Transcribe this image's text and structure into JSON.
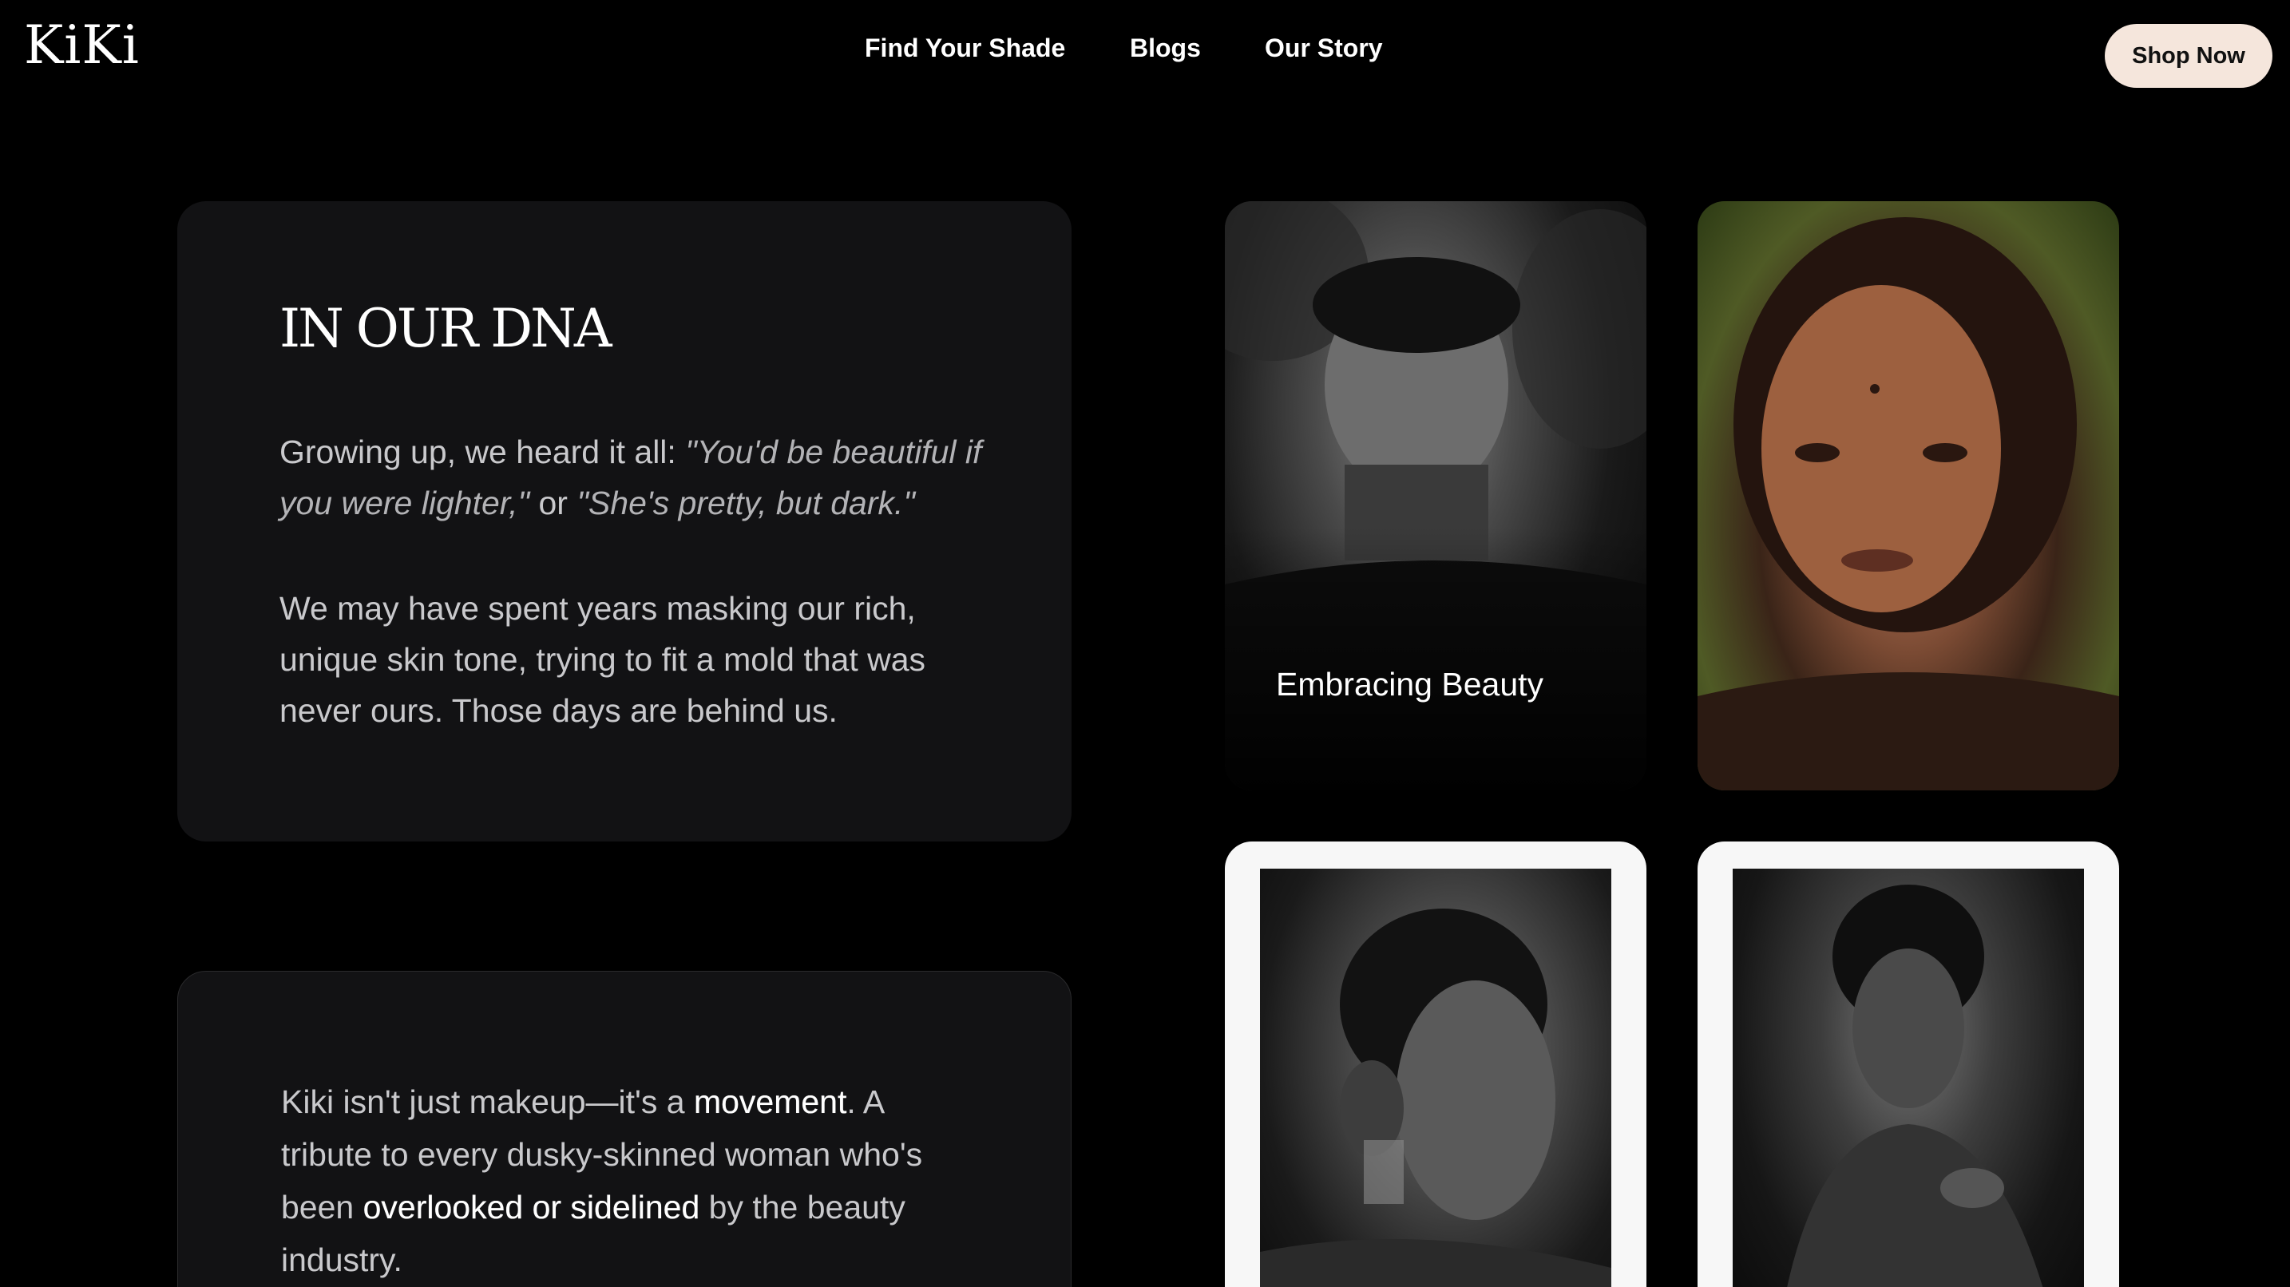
{
  "header": {
    "logo": "KiKi",
    "nav": [
      {
        "label": "Find Your Shade"
      },
      {
        "label": "Blogs"
      },
      {
        "label": "Our Story"
      }
    ],
    "cta": "Shop Now"
  },
  "dna_card": {
    "title": "IN OUR DNA",
    "para1_lead": "Growing up, we heard it all: ",
    "para1_quote1": "\"You'd be beautiful if you were lighter,\"",
    "para1_or": " or ",
    "para1_quote2": "\"She's pretty, but dark.\"",
    "para2": "We may have spent years masking our rich, unique skin tone, trying to fit a mold that was never ours. Those days are behind us."
  },
  "movement_card": {
    "part1": "Kiki isn't just makeup—it's a ",
    "strong1": "movement",
    "part2": ". A tribute to every dusky-skinned woman who's been ",
    "strong2": "overlooked or sidelined",
    "part3": " by the beauty industry."
  },
  "gallery": {
    "caption": "Embracing Beauty"
  },
  "colors": {
    "background": "#000000",
    "card": "#121214",
    "cta_bg": "#f5e6dc"
  }
}
